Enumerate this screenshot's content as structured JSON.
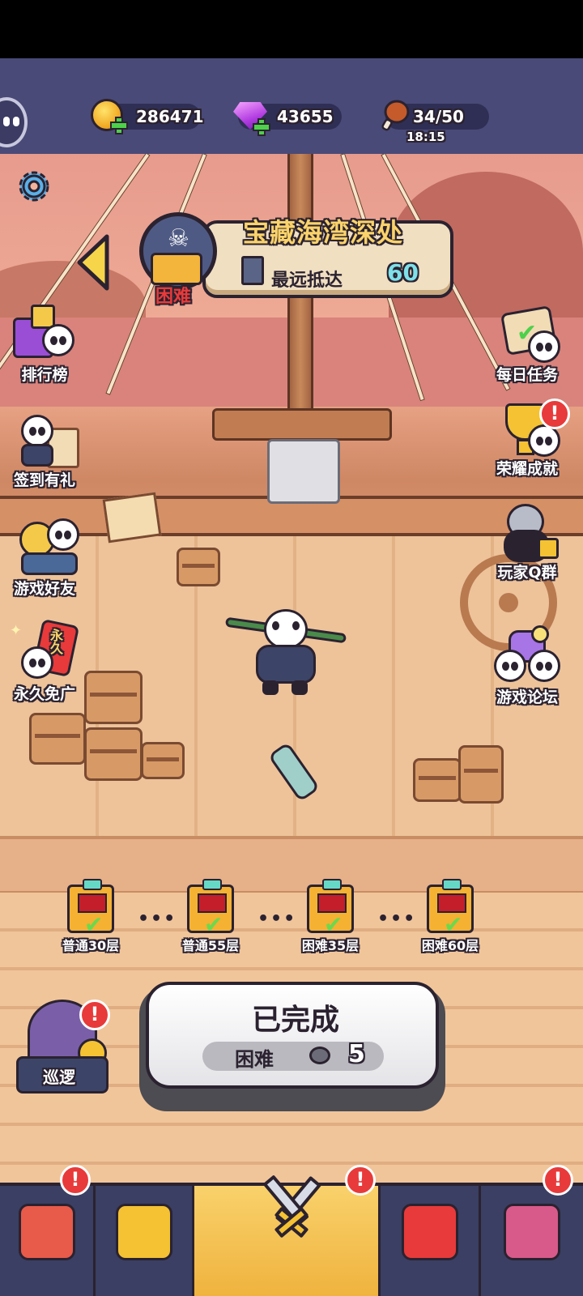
{
  "resources": {
    "coins": "286471",
    "gems": "43655",
    "stamina": "34/50",
    "stamina_timer": "18:15"
  },
  "level": {
    "title": "宝藏海湾深处",
    "farthest_label": "最远抵达",
    "farthest_value": "60",
    "difficulty": "困难"
  },
  "left_menu": [
    {
      "label": "排行榜"
    },
    {
      "label": "签到有礼"
    },
    {
      "label": "游戏好友"
    },
    {
      "label": "永久免广",
      "badge": "永久"
    }
  ],
  "right_menu": [
    {
      "label": "每日任务"
    },
    {
      "label": "荣耀成就"
    },
    {
      "label": "玩家Q群"
    },
    {
      "label": "游戏论坛"
    }
  ],
  "rewards": [
    {
      "label": "普通30层",
      "claimed": true
    },
    {
      "label": "普通55层",
      "claimed": true
    },
    {
      "label": "困难35层",
      "claimed": true
    },
    {
      "label": "困难60层",
      "claimed": true
    }
  ],
  "complete_button": {
    "title": "已完成",
    "difficulty": "困难",
    "count": "5"
  },
  "patrol": {
    "label": "巡逻"
  },
  "nav": {
    "tabs": [
      "shop",
      "collection",
      "battle",
      "talent",
      "castle"
    ],
    "active": "battle"
  },
  "colors": {
    "alert": "#e83a3a",
    "gold_text": "#fbd36a",
    "accent_cyan": "#7ee0e8"
  }
}
